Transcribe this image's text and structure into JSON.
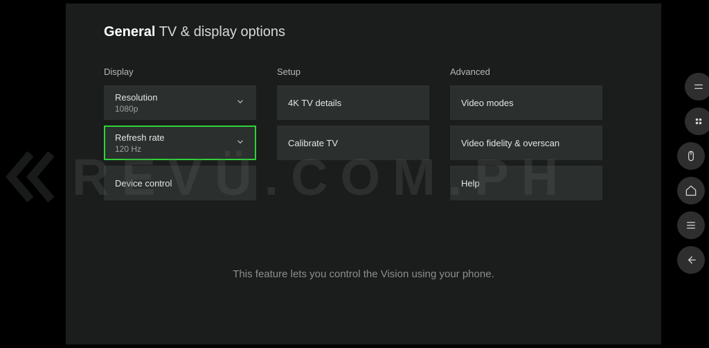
{
  "title": {
    "bold": "General",
    "rest": "TV & display options"
  },
  "display": {
    "label": "Display",
    "resolution": {
      "label": "Resolution",
      "value": "1080p"
    },
    "refresh": {
      "label": "Refresh rate",
      "value": "120 Hz"
    },
    "device_control": "Device control"
  },
  "setup": {
    "label": "Setup",
    "details": "4K TV details",
    "calibrate": "Calibrate TV"
  },
  "advanced": {
    "label": "Advanced",
    "modes": "Video modes",
    "fidelity": "Video fidelity & overscan",
    "help": "Help"
  },
  "description": "This feature lets you control the Vision using your phone.",
  "watermark": "REVÜ.COM.PH"
}
